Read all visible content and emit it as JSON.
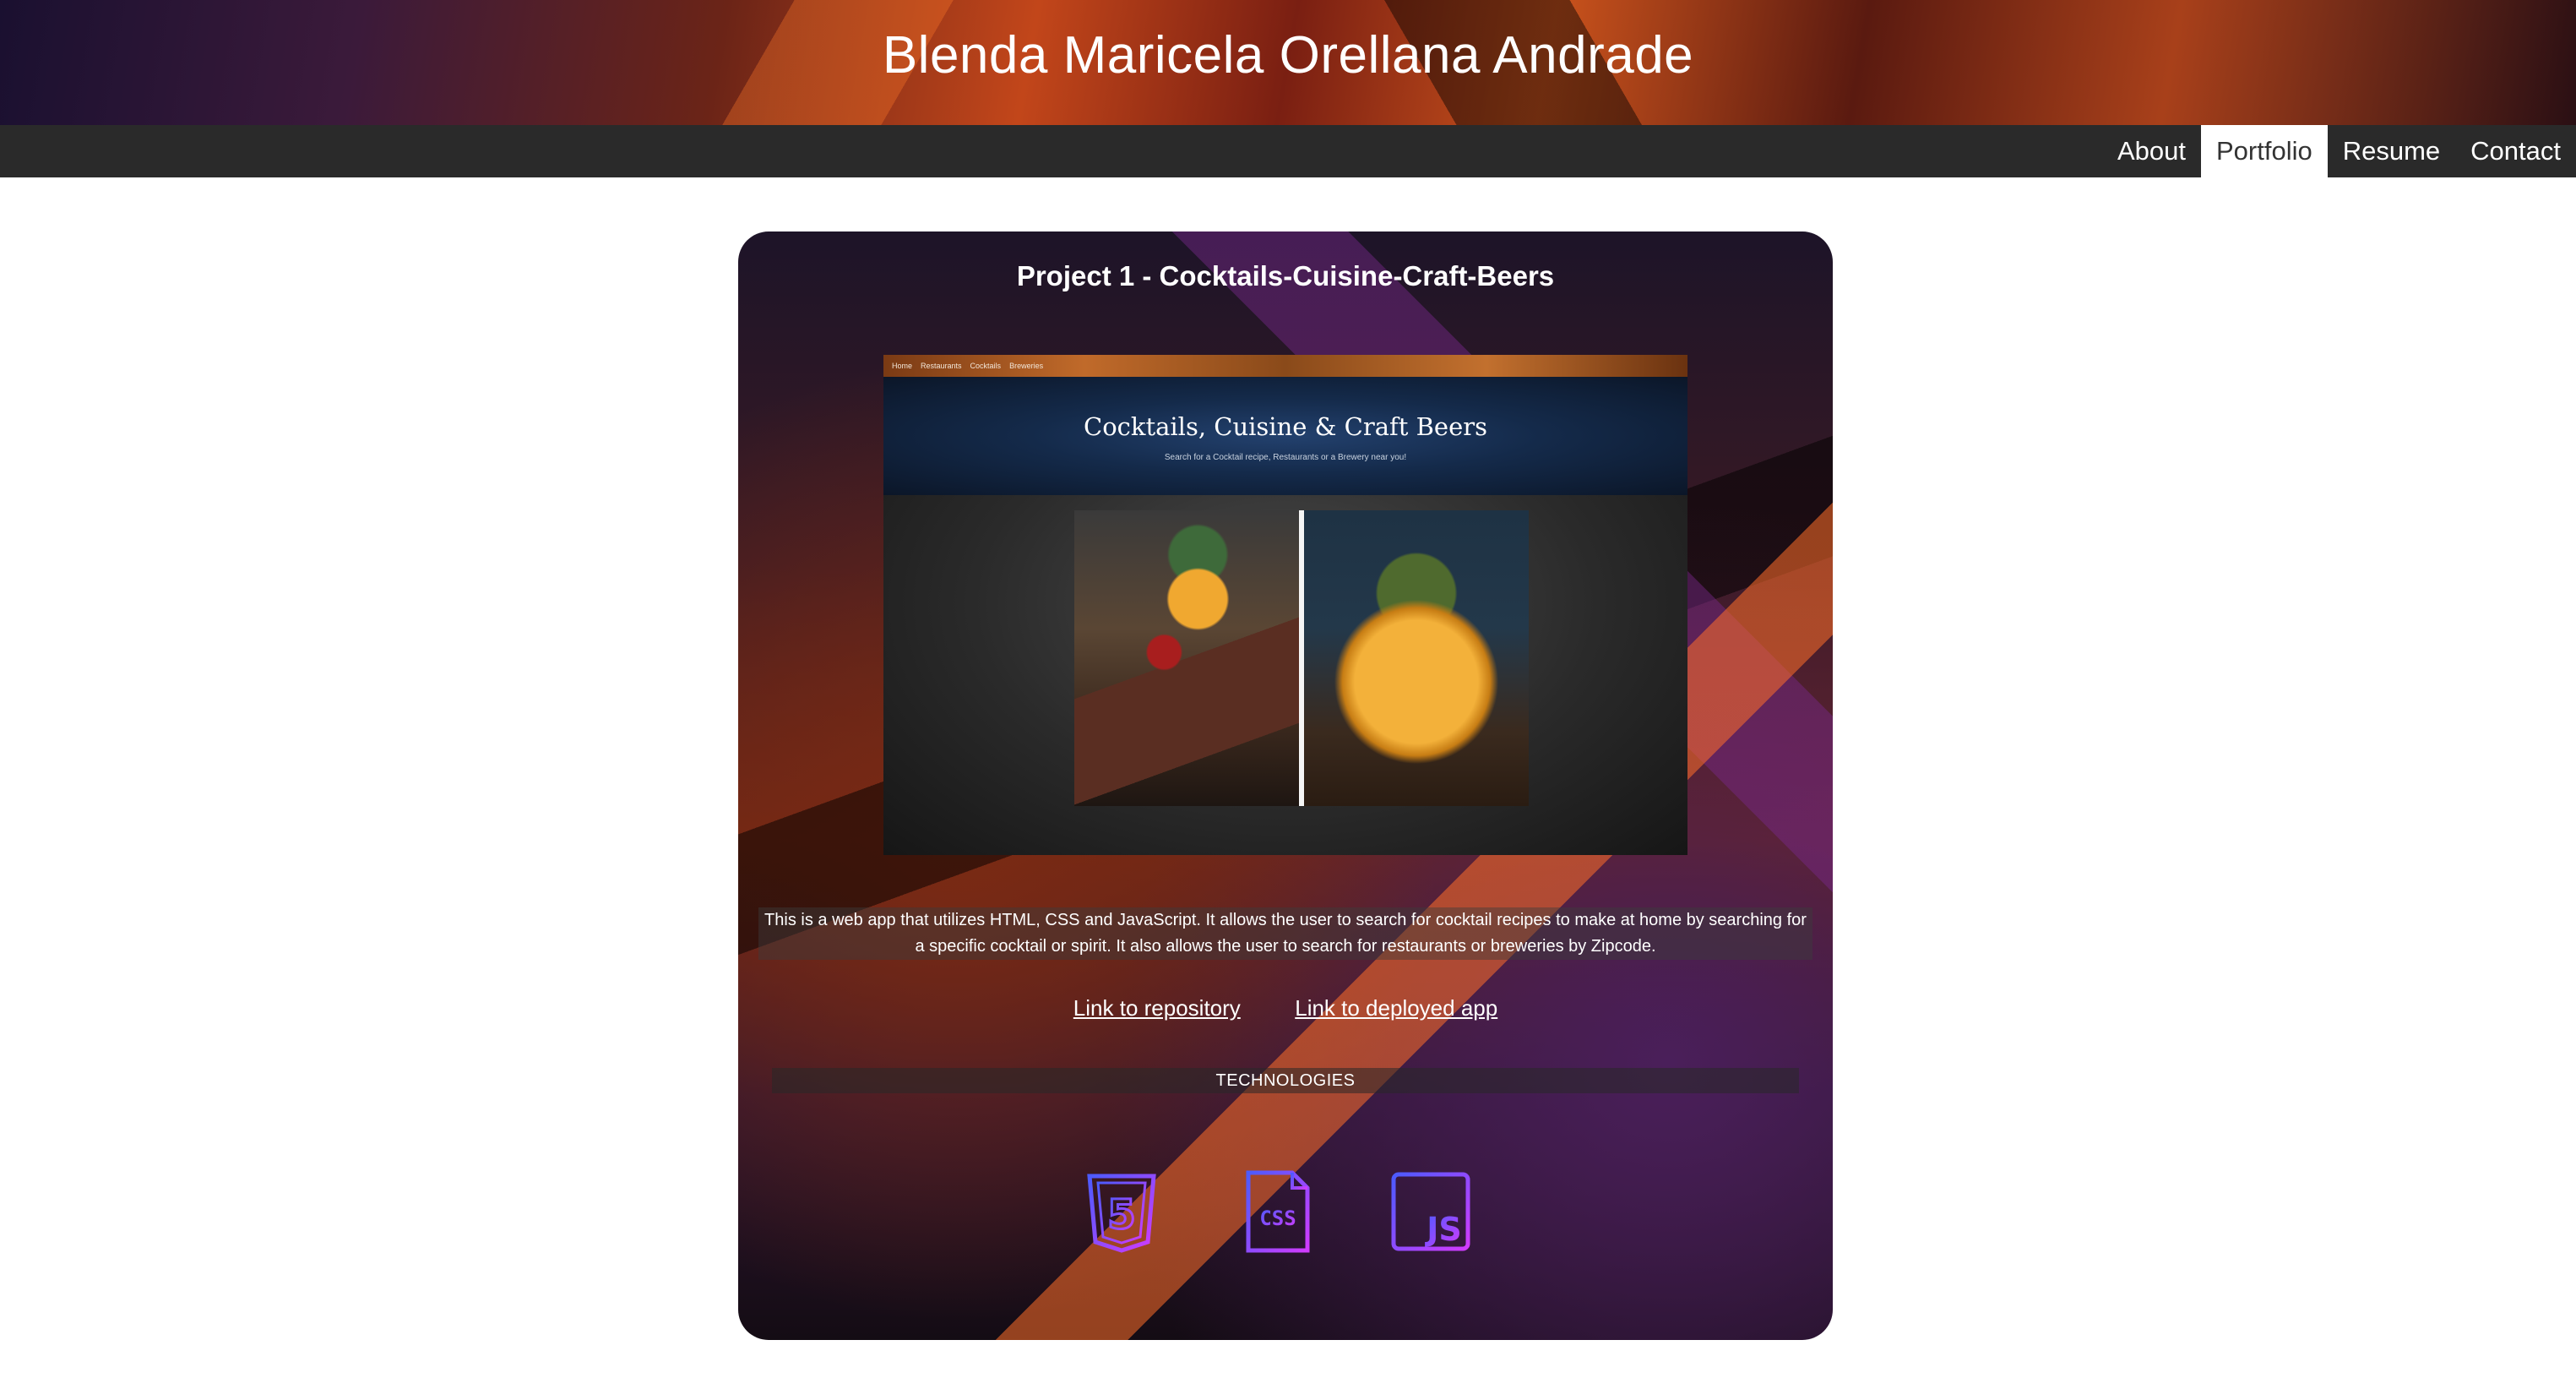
{
  "header": {
    "title": "Blenda Maricela Orellana Andrade"
  },
  "nav": {
    "items": [
      {
        "label": "About",
        "active": false
      },
      {
        "label": "Portfolio",
        "active": true
      },
      {
        "label": "Resume",
        "active": false
      },
      {
        "label": "Contact",
        "active": false
      }
    ]
  },
  "project": {
    "title": "Project 1 - Cocktails-Cuisine-Craft-Beers",
    "screenshot": {
      "nav_items": [
        "Home",
        "Restaurants",
        "Cocktails",
        "Breweries"
      ],
      "hero_title": "Cocktails, Cuisine & Craft Beers",
      "hero_subtitle": "Search for a Cocktail recipe, Restaurants or a Brewery near you!"
    },
    "description": "This is a web app that utilizes HTML, CSS and JavaScript. It allows the user to search for cocktail recipes to make at home by searching for a specific cocktail or spirit. It also allows the user to search for restaurants or breweries by Zipcode.",
    "links": {
      "repository": "Link to repository",
      "deployed": "Link to deployed app"
    },
    "technologies_heading": "TECHNOLOGIES",
    "technologies": [
      {
        "icon": "html5-icon",
        "text": "5"
      },
      {
        "icon": "css-file-icon",
        "text": "CSS"
      },
      {
        "icon": "javascript-icon",
        "text": "JS"
      }
    ]
  },
  "colors": {
    "nav_bg": "#2a2a2a",
    "icon_gradient_start": "#4b5bff",
    "icon_gradient_end": "#d13bff"
  }
}
